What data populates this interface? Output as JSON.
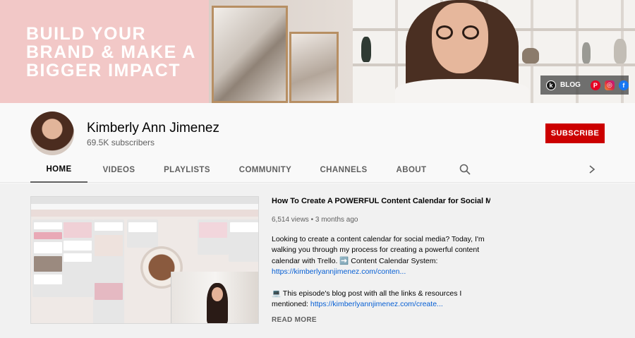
{
  "banner": {
    "tagline": [
      "BUILD YOUR",
      "BRAND & MAKE A",
      "BIGGER IMPACT"
    ],
    "links_label": "BLOG",
    "link_icons": [
      "blog-icon",
      "pinterest-icon",
      "instagram-icon",
      "facebook-icon"
    ]
  },
  "channel": {
    "name": "Kimberly Ann Jimenez",
    "subscribers": "69.5K subscribers",
    "subscribe_label": "SUBSCRIBE"
  },
  "tabs": [
    {
      "label": "HOME",
      "active": true
    },
    {
      "label": "VIDEOS",
      "active": false
    },
    {
      "label": "PLAYLISTS",
      "active": false
    },
    {
      "label": "COMMUNITY",
      "active": false
    },
    {
      "label": "CHANNELS",
      "active": false
    },
    {
      "label": "ABOUT",
      "active": false
    }
  ],
  "featured_video": {
    "title": "How To Create A POWERFUL Content Calendar for Social M...",
    "views": "6,514 views",
    "age": "3 months ago",
    "description_1": "Looking to create a content calendar for social media? Today, I'm walking you through my process for creating a powerful content calendar with Trello. ➡️ Content Calendar System:",
    "link_1": "https://kimberlyannjimenez.com/conten...",
    "description_2": "💻  This episode's blog post with all the links & resources I mentioned:",
    "link_2": "https://kimberlyannjimenez.com/create...",
    "read_more": "READ MORE"
  },
  "colors": {
    "subscribe": "#cc0000",
    "link": "#065fd4",
    "banner_pink": "#f2c8c7"
  }
}
